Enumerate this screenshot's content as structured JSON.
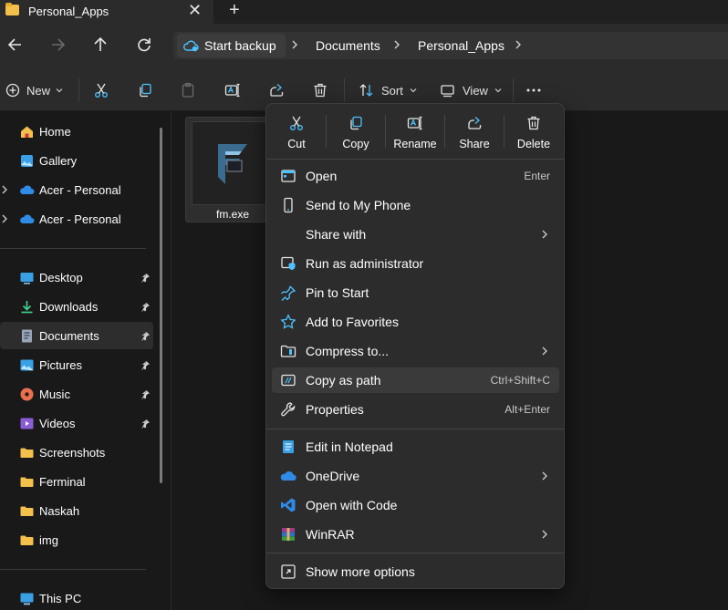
{
  "tab": {
    "title": "Personal_Apps"
  },
  "address": {
    "backup_label": "Start backup",
    "crumbs": [
      "Documents",
      "Personal_Apps"
    ]
  },
  "toolbar": {
    "new_label": "New",
    "sort_label": "Sort",
    "view_label": "View"
  },
  "sidebar": {
    "items": [
      {
        "label": "Home"
      },
      {
        "label": "Gallery"
      },
      {
        "label": "Acer - Personal"
      },
      {
        "label": "Acer - Personal"
      },
      {
        "label": "Desktop"
      },
      {
        "label": "Downloads"
      },
      {
        "label": "Documents"
      },
      {
        "label": "Pictures"
      },
      {
        "label": "Music"
      },
      {
        "label": "Videos"
      },
      {
        "label": "Screenshots"
      },
      {
        "label": "Ferminal"
      },
      {
        "label": "Naskah"
      },
      {
        "label": "img"
      },
      {
        "label": "This PC"
      }
    ]
  },
  "file": {
    "name": "fm.exe"
  },
  "context_menu": {
    "quick_actions": [
      {
        "label": "Cut"
      },
      {
        "label": "Copy"
      },
      {
        "label": "Rename"
      },
      {
        "label": "Share"
      },
      {
        "label": "Delete"
      }
    ],
    "items": [
      {
        "label": "Open",
        "shortcut": "Enter"
      },
      {
        "label": "Send to My Phone"
      },
      {
        "label": "Share with"
      },
      {
        "label": "Run as administrator"
      },
      {
        "label": "Pin to Start"
      },
      {
        "label": "Add to Favorites"
      },
      {
        "label": "Compress to..."
      },
      {
        "label": "Copy as path",
        "shortcut": "Ctrl+Shift+C"
      },
      {
        "label": "Properties",
        "shortcut": "Alt+Enter"
      },
      {
        "label": "Edit in Notepad"
      },
      {
        "label": "OneDrive"
      },
      {
        "label": "Open with Code"
      },
      {
        "label": "WinRAR"
      },
      {
        "label": "Show more options"
      }
    ]
  },
  "colors": {
    "accent": "#4cc2ff",
    "folder": "#f2c04b",
    "background": "#191919",
    "menu": "#2c2c2c"
  }
}
